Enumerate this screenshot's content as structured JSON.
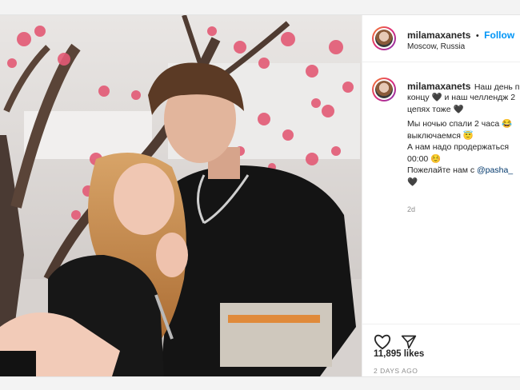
{
  "post": {
    "username": "milamaxanets",
    "follow_label": "Follow",
    "separator": "•",
    "location": "Moscow, Russia",
    "caption_lines": [
      "Наш день п",
      "концу 🖤 и наш челлендж 2",
      "цепях тоже 🖤",
      "Мы ночью спали 2 часа 😂",
      "выключаемся 😇",
      "А нам надо продержаться",
      "00:00 ☺️",
      "Пожелайте нам с",
      "🖤"
    ],
    "mention": "@pasha_",
    "age": "2d",
    "likes": "11,895 likes",
    "date": "2 DAYS AGO"
  },
  "icons": {
    "like": "heart-icon",
    "share": "share-icon"
  },
  "colors": {
    "accent": "#0095f6",
    "text": "#262626",
    "muted": "#8e8e8e",
    "blossom": "#e35a75"
  }
}
